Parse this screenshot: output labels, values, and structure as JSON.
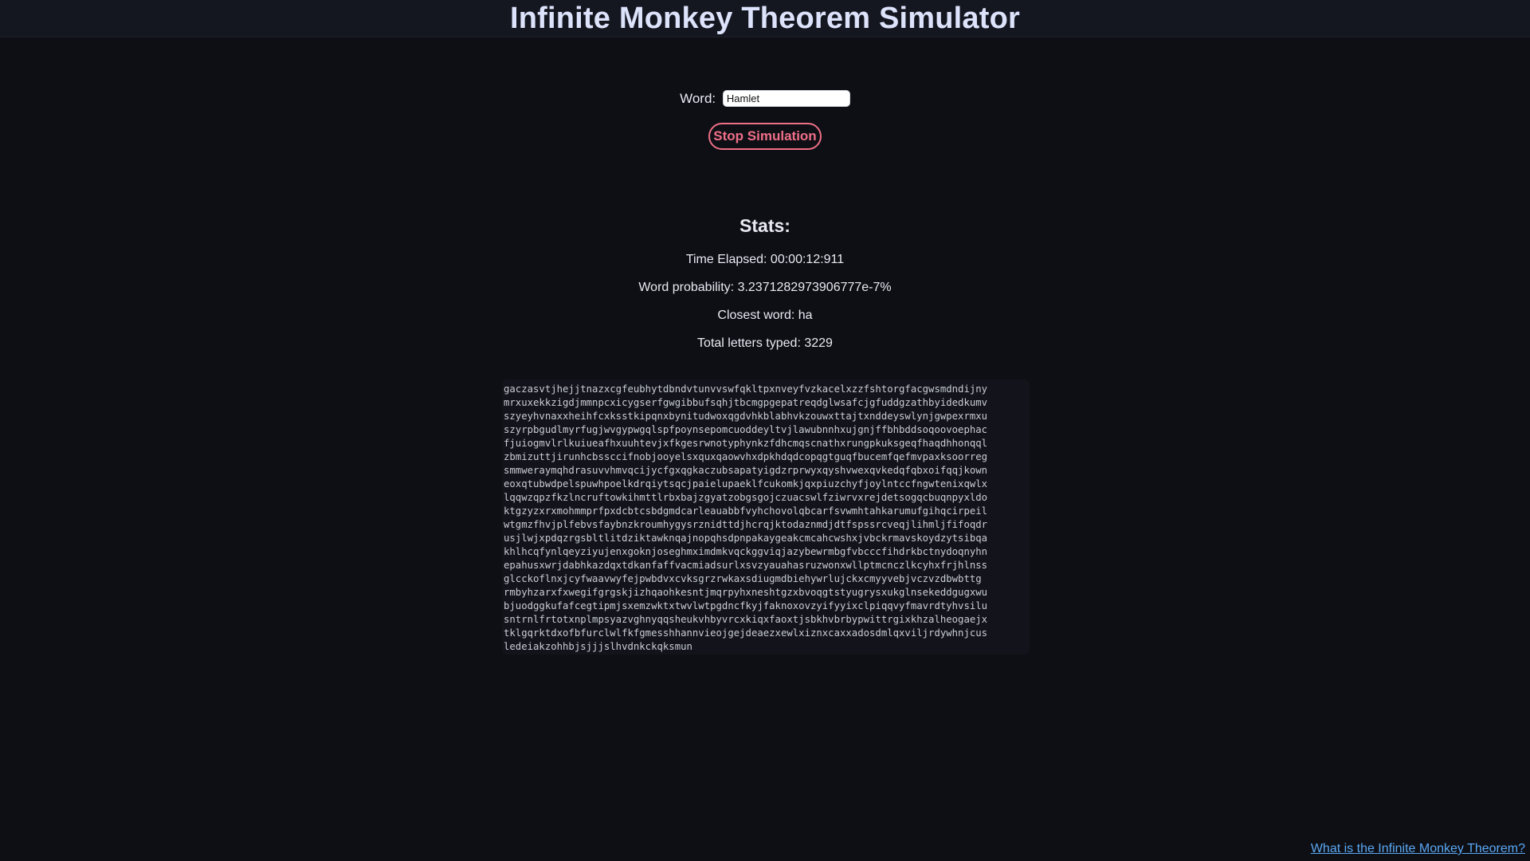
{
  "header": {
    "title": "Infinite Monkey Theorem Simulator"
  },
  "controls": {
    "word_label": "Word:",
    "word_value": "Hamlet",
    "stop_button_label": "Stop Simulation"
  },
  "stats": {
    "heading": "Stats:",
    "time_elapsed": "Time Elapsed: 00:00:12:911",
    "word_probability": "Word probability: 3.2371282973906777e-7%",
    "closest_word": "Closest word: ha",
    "total_letters": "Total letters typed: 3229"
  },
  "output": {
    "lines": [
      "gaczasvtjhejjtnazxcgfeubhytdbndvtunvvswfqkltpxnveyfvzkacelxzzfshtorgfacgwsmdndijny",
      "mrxuxekkzigdjmmnpcxicygserfgwgibbufsqhjtbcmgpgepatreqdglwsafcjgfuddgzathbyidedkumv",
      "szyeyhvnaxxheihfcxksstkipqnxbynitudwoxqgdvhkblabhvkzouwxttajtxnddeyswlynjgwpexrmxu",
      "szyrpbgudlmyrfugjwvgypwgqlspfpoynsepomcuoddeyltvjlawubnnhxujgnjffbhbddsoqoovoephac",
      "fjuiogmvlrlkuiueafhxuuhtevjxfkgesrwnotyphynkzfdhcmqscnathxrungpkuksgeqfhaqdhhonqql",
      "zbmizuttjirunhcbssccifnobjooyelsxquxqaowvhxdpkhdqdcopqgtguqfbucemfqefmvpaxksoorreg",
      "smmweraymqhdrasuvvhmvqcijycfgxqgkaczubsapatyigdzrprwyxqyshvwexqvkedqfqbxoifqqjkown",
      "eoxqtubwdpelspuwhpoelkdrqiytsqcjpaielupaeklfcukomkjqxpiuzchyfjoylntccfngwtenixqwlx",
      "lqqwzqpzfkzlncruftowkihmttlrbxbajzgyatzobgsgojczuacswlfziwrvxrejdetsogqcbuqnpyxldo",
      "ktgzyzxrxmohmmprfpxdcbtcsbdgmdcarleauabbfvyhchovolqbcarfsvwmhtahkarumufgihqcirpeil",
      "wtgmzfhvjplfebvsfaybnzkroumhygysrznidttdjhcrqjktodaznmdjdtfspssrcveqjlihmljfifoqdr",
      "usjlwjxpdqzrgsbltlitdziktawknqajnopqhsdpnpakaygeakcmcahcwshxjvbckrmavskoydzytsibqa",
      "khlhcqfynlqeyziyujenxgoknjoseghmximdmkvqckggviqjazybewrmbgfvbcccfihdrkbctnydoqnyhn",
      "epahusxwrjdabhkazdqxtdkanfaffvacmiadsurlxsvzyauahasruzwonxwllptmcnczlkcyhxfrjhlnss",
      "glcckoflnxjcyfwaavwyfejpwbdvxcvksgrzrwkaxsdiugmdbiehywrlujckxcmyyvebjvczvzdbwbttg",
      "rmbyhzarxfxwegifgrgskjizhqaohkesntjmqrpyhxneshtgzxbvoqgtstyugrysxukglnsekeddgugxwu",
      "bjuodggkufafcegtipmjsxemzwktxtwvlwtpgdncfkyjfaknoxovzyifyyixclpiqqvyfmavrdtyhvsilu",
      "sntrnlfrtotxnplmpsyazvghnyqqsheukvhbyvrcxkiqxfaoxtjsbkhvbrbypwittrgixkhzalheogaejx",
      "tklgqrktdxofbfurclwlfkfgmesshhannvieojgejdeaezxewlxiznxcaxxadosdmlqxviljrdywhnjcus",
      "ledeiakzohhbjsjjjslhvdnkckqksmun"
    ]
  },
  "footer": {
    "link_label": "What is the Infinite Monkey Theorem?"
  }
}
